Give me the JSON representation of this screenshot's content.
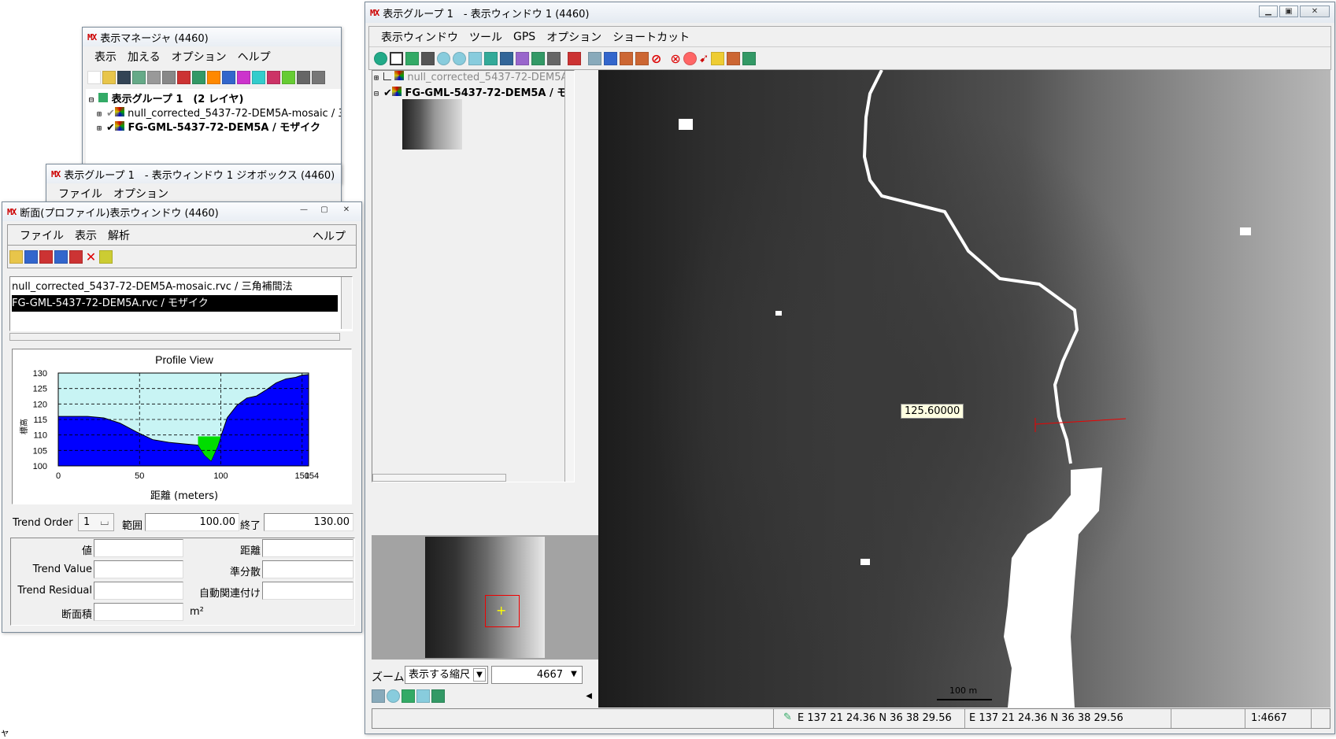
{
  "display_manager": {
    "title": "表示マネージャ (4460)",
    "menu": [
      "表示",
      "加える",
      "オプション",
      "ヘルプ"
    ],
    "tree": [
      {
        "label": "表示グループ 1　(2 レイヤ)",
        "bold": true
      },
      {
        "label": "null_corrected_5437-72-DEM5A-mosaic / 三",
        "bold": false
      },
      {
        "label": "FG-GML-5437-72-DEM5A / モザイク",
        "bold": true
      }
    ]
  },
  "geobox_window": {
    "title": "表示グループ 1　- 表示ウィンドウ 1 ジオボックス (4460)",
    "menu": [
      "ファイル",
      "オプション"
    ]
  },
  "profile_window": {
    "title": "断面(プロファイル)表示ウィンドウ (4460)",
    "menu": [
      "ファイル",
      "表示",
      "解析"
    ],
    "menu_help": "ヘルプ",
    "layers": [
      "null_corrected_5437-72-DEM5A-mosaic.rvc / 三角補間法",
      "FG-GML-5437-72-DEM5A.rvc / モザイク"
    ],
    "fields": {
      "trend_order_label": "Trend Order",
      "trend_order_value": "1",
      "range_label": "範囲",
      "range_value": "100.00",
      "end_label": "終了",
      "end_value": "130.00",
      "value_label": "値",
      "distance_label": "距離",
      "trend_value_label": "Trend Value",
      "semivariance_label": "準分散",
      "trend_residual_label": "Trend Residual",
      "autocorr_label": "自動関連付け",
      "area_label": "断面積",
      "area_unit": "m²"
    }
  },
  "chart_data": {
    "type": "area",
    "title": "Profile View",
    "xlabel": "距離 (meters)",
    "ylabel": "標高",
    "xlim": [
      0,
      154
    ],
    "ylim": [
      100,
      130
    ],
    "x_ticks": [
      "0",
      "50",
      "100",
      "150"
    ],
    "x_end_label": "154",
    "y_ticks": [
      "100",
      "105",
      "110",
      "115",
      "120",
      "125",
      "130"
    ],
    "grid": true,
    "colors": {
      "profile_fill": "#0000ff",
      "background": "#c8f4f4",
      "water_fill": "#00dd00"
    },
    "series": [
      {
        "x": [
          0,
          8,
          18,
          28,
          38,
          48,
          58,
          68,
          78,
          86,
          90,
          94,
          98,
          100,
          104,
          110,
          116,
          122,
          128,
          134,
          140,
          146,
          150,
          154
        ],
        "y": [
          116,
          116,
          116,
          115.5,
          113.8,
          111,
          108.5,
          107.6,
          107.1,
          106.7,
          103.5,
          101.6,
          106.3,
          109.5,
          115.6,
          119.6,
          121.9,
          122.6,
          124.6,
          126.8,
          128.1,
          128.6,
          129.3,
          129.5
        ]
      }
    ],
    "water": [
      {
        "x": [
          86,
          90,
          94,
          98,
          100
        ],
        "y": [
          106.7,
          103.5,
          101.6,
          106.3,
          109.5
        ],
        "level": 109.5
      }
    ]
  },
  "main_window": {
    "title": "表示グループ 1　- 表示ウィンドウ 1 (4460)",
    "menu": [
      "表示ウィンドウ",
      "ツール",
      "GPS",
      "オプション",
      "ショートカット"
    ],
    "layers": [
      {
        "label": "null_corrected_5437-72-DEM5A-m",
        "checked": false
      },
      {
        "label": "FG-GML-5437-72-DEM5A / モザ",
        "checked": true
      }
    ],
    "zoom_label": "ズーム",
    "zoom_mode": "表示する縮尺",
    "zoom_value": "4667",
    "tooltip_value": "125.60000",
    "scalebar_label": "100 m",
    "status": {
      "coord1": "E 137 21 24.36  N 36 38 29.56",
      "coord2": "E 137 21 24.36  N 36 38 29.56",
      "scale": "1:4667"
    }
  },
  "desktop_fragment": "ャ"
}
